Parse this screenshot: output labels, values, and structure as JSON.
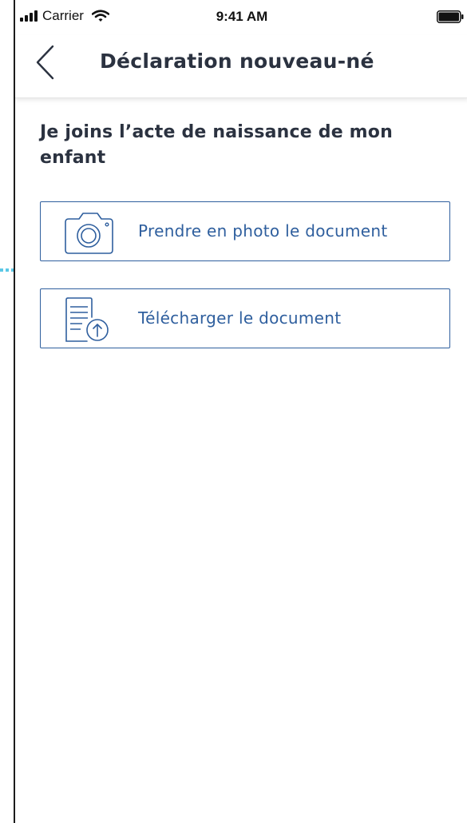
{
  "status_bar": {
    "carrier": "Carrier",
    "time": "9:41 AM"
  },
  "nav": {
    "title": "Déclaration nouveau-né"
  },
  "main": {
    "question": "Je joins l’acte de naissance de mon enfant",
    "options": [
      {
        "label": "Prendre en photo le document",
        "icon": "camera-icon"
      },
      {
        "label": "Télécharger le document",
        "icon": "document-upload-icon"
      }
    ]
  },
  "colors": {
    "accent": "#2f5f9e",
    "text": "#2b3240",
    "flow_arrow": "#5bc8e6"
  }
}
